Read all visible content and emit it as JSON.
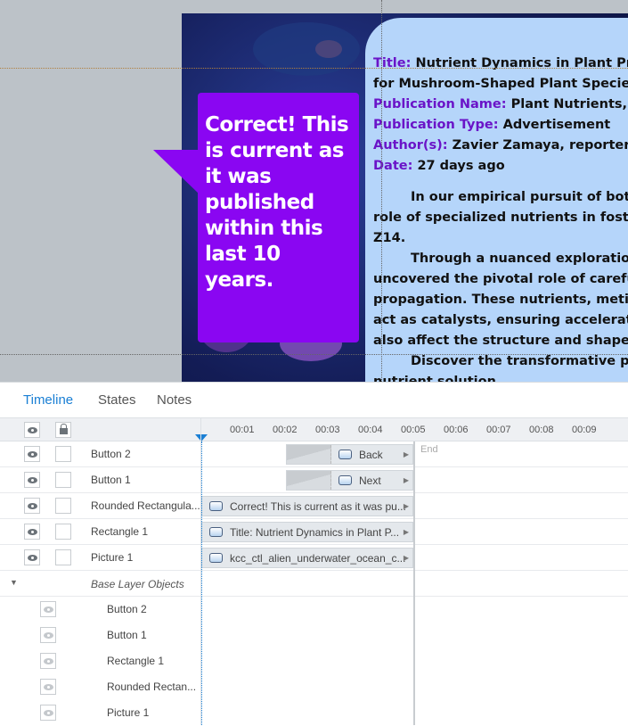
{
  "slide": {
    "callout": "Correct! This is current as it was published within this last 10 years.",
    "panel": {
      "title_label": "Title:",
      "title": "Nutrient Dynamics in Plant Proliferation",
      "title_line2": "for Mushroom-Shaped Plant Species",
      "pubname_label": "Publication Name:",
      "pubname": "Plant Nutrients, Inc.",
      "pubtype_label": "Publication Type:",
      "pubtype": "Advertisement",
      "author_label": "Author(s):",
      "author": "Zavier Zamaya, reporter",
      "date_label": "Date:",
      "date": "27 days ago",
      "p1a": "In our empirical pursuit of botanical",
      "p1b": "role of specialized nutrients in fostering",
      "p1c": "Z14.",
      "p2a": "Through a nuanced exploration of",
      "p2b": "uncovered the pivotal role of carefully ba",
      "p2c": "propagation. These nutrients, meticulous",
      "p2d": "act as catalysts, ensuring accelerated g",
      "p2e": "also affect the structure and shape of th",
      "p3a": "Discover the transformative potential",
      "p3b": "nutrient solution."
    }
  },
  "timeline": {
    "tabs": [
      "Timeline",
      "States",
      "Notes"
    ],
    "ticks": [
      "00:01",
      "00:02",
      "00:03",
      "00:04",
      "00:05",
      "00:06",
      "00:07",
      "00:08",
      "00:09"
    ],
    "end_label": "End",
    "rows": [
      {
        "name": "Button 2",
        "track": "Back"
      },
      {
        "name": "Button 1",
        "track": "Next"
      },
      {
        "name": "Rounded Rectangula...",
        "track": "Correct! This is current as it was pu..."
      },
      {
        "name": "Rectangle 1",
        "track": "Title: Nutrient Dynamics in Plant P..."
      },
      {
        "name": "Picture 1",
        "track": "kcc_ctl_alien_underwater_ocean_c..."
      }
    ],
    "base_layer_label": "Base Layer Objects",
    "base_items": [
      "Button 2",
      "Button 1",
      "Rectangle 1",
      "Rounded Rectan...",
      "Picture 1"
    ]
  }
}
